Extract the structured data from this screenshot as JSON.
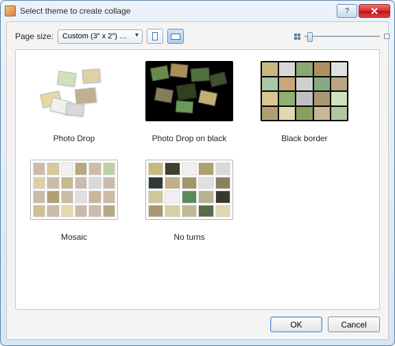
{
  "window": {
    "title": "Select theme to create collage"
  },
  "toolbar": {
    "page_size_label": "Page size:",
    "page_size_value": "Custom (3″ x 2″) …"
  },
  "themes": [
    {
      "label": "Photo Drop"
    },
    {
      "label": "Photo Drop on black"
    },
    {
      "label": "Black border"
    },
    {
      "label": "Mosaic"
    },
    {
      "label": "No turns"
    }
  ],
  "footer": {
    "ok": "OK",
    "cancel": "Cancel"
  }
}
